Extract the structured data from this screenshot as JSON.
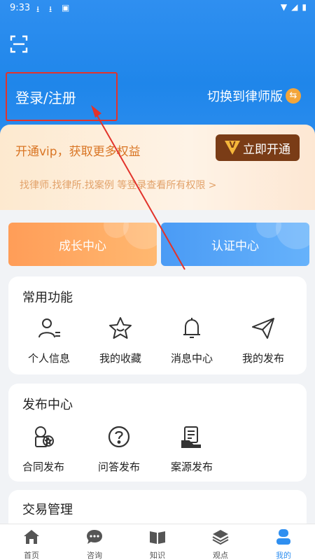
{
  "status": {
    "time": "9:33"
  },
  "header": {
    "login_label": "登录/注册",
    "switch_label": "切换到律师版",
    "switch_badge": "⇆"
  },
  "vip": {
    "promo": "开通vip，获取更多权益",
    "button": "立即开通",
    "subtitle": "找律师.找律所.找案例 等登录查看所有权限 >"
  },
  "cards": {
    "growth": "成长中心",
    "certification": "认证中心"
  },
  "common_functions": {
    "title": "常用功能",
    "items": [
      {
        "label": "个人信息",
        "icon": "person-info-icon"
      },
      {
        "label": "我的收藏",
        "icon": "star-icon"
      },
      {
        "label": "消息中心",
        "icon": "bell-icon"
      },
      {
        "label": "我的发布",
        "icon": "paper-plane-icon"
      }
    ]
  },
  "publish_center": {
    "title": "发布中心",
    "items": [
      {
        "label": "合同发布",
        "icon": "contract-icon"
      },
      {
        "label": "问答发布",
        "icon": "question-icon"
      },
      {
        "label": "案源发布",
        "icon": "case-source-icon"
      }
    ]
  },
  "trade": {
    "title": "交易管理"
  },
  "tabbar": {
    "items": [
      {
        "label": "首页",
        "icon": "home-icon"
      },
      {
        "label": "咨询",
        "icon": "chat-icon"
      },
      {
        "label": "知识",
        "icon": "book-icon"
      },
      {
        "label": "观点",
        "icon": "layers-icon"
      },
      {
        "label": "我的",
        "icon": "profile-icon",
        "active": true
      }
    ]
  },
  "colors": {
    "header_blue": "#2f8ff0",
    "annotation_red": "#e2332b",
    "vip_brown": "#7a3c16",
    "vip_orange": "#d97524"
  }
}
